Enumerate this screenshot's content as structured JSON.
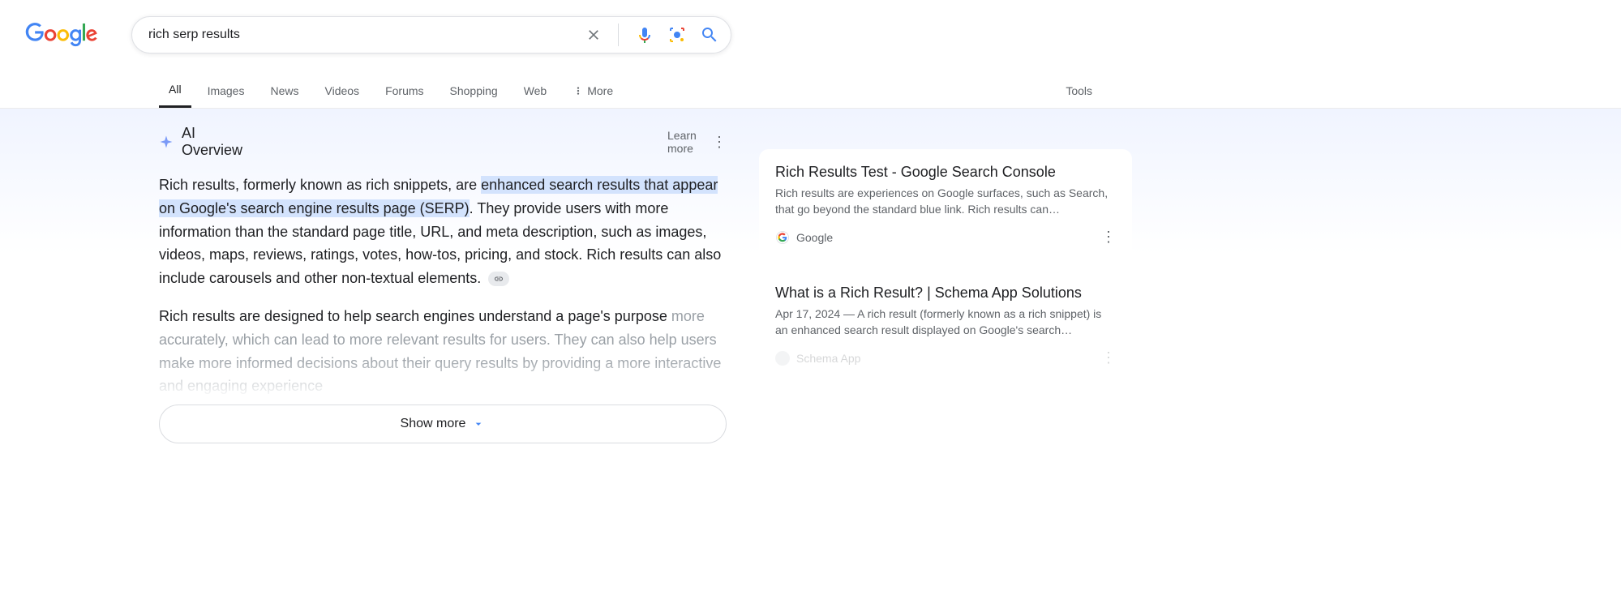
{
  "search": {
    "query": "rich serp results"
  },
  "tabs": {
    "all": "All",
    "images": "Images",
    "news": "News",
    "videos": "Videos",
    "forums": "Forums",
    "shopping": "Shopping",
    "web": "Web",
    "more": "More",
    "tools": "Tools"
  },
  "ai": {
    "title": "AI Overview",
    "learn_more": "Learn more",
    "p1a": "Rich results, formerly known as rich snippets, are ",
    "p1hl": "enhanced search results that appear on Google's search engine results page (SERP)",
    "p1b": ". They provide users with more information than the standard page title, URL, and meta description, such as images, videos, maps, reviews, ratings, votes, how-tos, pricing, and stock. Rich results can also include carousels and other non-textual elements.",
    "p2a": "Rich results are designed to help search engines understand a page's purpose",
    "p2b": " more accurately, which can lead to more relevant results for users. They can also help users make more informed decisions about their query results by providing a more interactive and engaging experience",
    "show_more": "Show more"
  },
  "cards": [
    {
      "title": "Rich Results Test - Google Search Console",
      "desc": "Rich results are experiences on Google surfaces, such as Search, that go beyond the standard blue link. Rich results can…",
      "source": "Google"
    },
    {
      "title": "What is a Rich Result? | Schema App Solutions",
      "desc": "Apr 17, 2024 — A rich result (formerly known as a rich snippet) is an enhanced search result displayed on Google's search…",
      "source": "Schema App"
    }
  ]
}
